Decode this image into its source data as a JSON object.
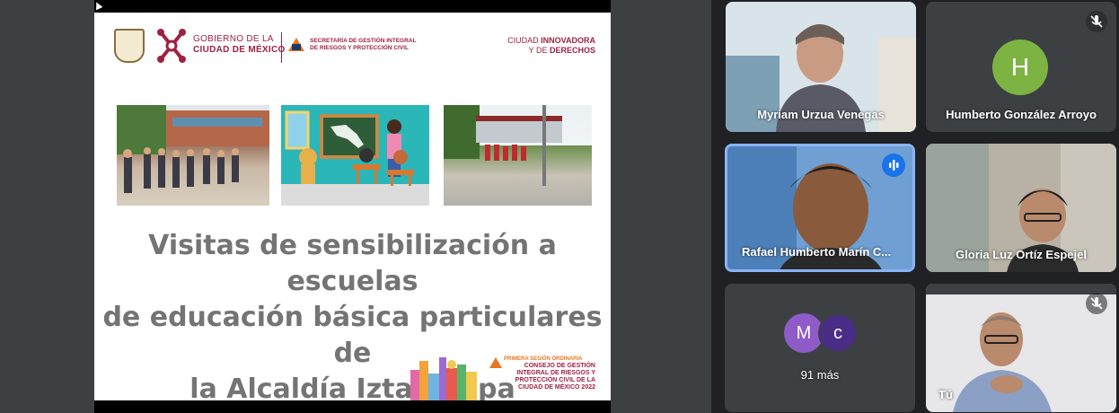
{
  "slide": {
    "gob_line1": "GOBIERNO DE LA",
    "gob_line2": "CIUDAD DE MÉXICO",
    "sgir_line1": "SECRETARÍA DE GESTIÓN INTEGRAL",
    "sgir_line2": "DE RIESGOS Y PROTECCIÓN CIVIL",
    "ciudad_line1_a": "CIUDAD ",
    "ciudad_line1_b": "INNOVADORA",
    "ciudad_line2_a": "Y DE ",
    "ciudad_line2_b": "DERECHOS",
    "title_line1": "Visitas de sensibilización a escuelas",
    "title_line2": "de educación básica particulares de",
    "title_line3": "la Alcaldía Iztapalapa",
    "footer_line1": "PRIMERA SESIÓN ORDINARIA",
    "footer_line2": "CONSEJO DE GESTIÓN",
    "footer_line3": "INTEGRAL DE RIESGOS Y",
    "footer_line4": "PROTECCIÓN CIVIL DE LA",
    "footer_line5": "CIUDAD DE MÉXICO 2022"
  },
  "participants": [
    {
      "name": "Myriam Urzua Venegas"
    },
    {
      "name": "Humberto González Arroyo",
      "initial": "H",
      "muted": true
    },
    {
      "name": "Rafael Humberto Marín C...",
      "speaking": true
    },
    {
      "name": "Gloria Luz Ortíz Espejel"
    },
    {
      "more_initial_1": "M",
      "more_initial_2": "c",
      "more_label": "91 más"
    },
    {
      "name": "Tú",
      "muted": true
    }
  ],
  "colors": {
    "brand": "#9f2241",
    "accent_orange": "#e87722",
    "speaking_blue": "#1a73e8",
    "avatar_green": "#7cb342"
  },
  "icons": [
    "mic-off-icon",
    "speaking-indicator-icon",
    "cursor-icon"
  ]
}
